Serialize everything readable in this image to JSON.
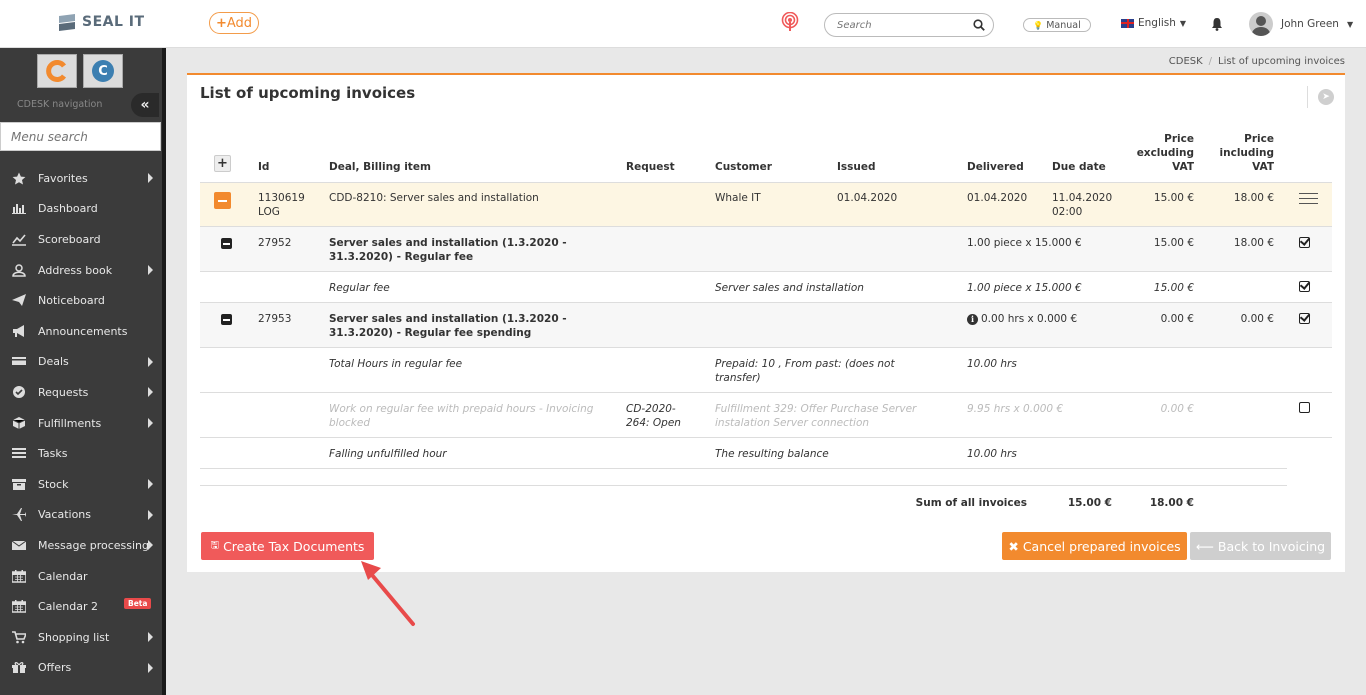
{
  "header": {
    "brand": "SEAL IT",
    "add_label": "Add",
    "search_placeholder": "Search",
    "manual_label": "Manual",
    "language": "English",
    "user_name": "John Green"
  },
  "sidebar": {
    "caption": "CDESK navigation",
    "app_icons": [
      "C",
      "C"
    ],
    "menu_search_placeholder": "Menu search",
    "items": [
      {
        "label": "Favorites",
        "icon": "star-icon",
        "submenu": true
      },
      {
        "label": "Dashboard",
        "icon": "bar-chart-icon",
        "submenu": false
      },
      {
        "label": "Scoreboard",
        "icon": "line-chart-icon",
        "submenu": false
      },
      {
        "label": "Address book",
        "icon": "user-icon",
        "submenu": true
      },
      {
        "label": "Noticeboard",
        "icon": "paper-plane-icon",
        "submenu": false
      },
      {
        "label": "Announcements",
        "icon": "bullhorn-icon",
        "submenu": false
      },
      {
        "label": "Deals",
        "icon": "money-icon",
        "submenu": true
      },
      {
        "label": "Requests",
        "icon": "check-circle-icon",
        "submenu": true
      },
      {
        "label": "Fulfillments",
        "icon": "cube-icon",
        "submenu": true
      },
      {
        "label": "Tasks",
        "icon": "tasks-icon",
        "submenu": false
      },
      {
        "label": "Stock",
        "icon": "archive-icon",
        "submenu": true
      },
      {
        "label": "Vacations",
        "icon": "plane-icon",
        "submenu": true
      },
      {
        "label": "Message processing",
        "icon": "envelope-icon",
        "submenu": true
      },
      {
        "label": "Calendar",
        "icon": "calendar-icon",
        "submenu": false
      },
      {
        "label": "Calendar 2",
        "icon": "calendar-icon",
        "submenu": false,
        "badge": "Beta"
      },
      {
        "label": "Shopping list",
        "icon": "cart-icon",
        "submenu": true
      },
      {
        "label": "Offers",
        "icon": "gift-icon",
        "submenu": true
      }
    ]
  },
  "breadcrumb": [
    "CDESK",
    "List of upcoming invoices"
  ],
  "page_title": "List of upcoming invoices",
  "table": {
    "headers": {
      "id": "Id",
      "deal": "Deal, Billing item",
      "request": "Request",
      "customer": "Customer",
      "issued": "Issued",
      "delivered": "Delivered",
      "due": "Due date",
      "price_ex_l1": "Price",
      "price_ex_l2": "excluding",
      "price_ex_l3": "VAT",
      "price_in_l1": "Price",
      "price_in_l2": "including",
      "price_in_l3": "VAT"
    },
    "invoice": {
      "id_l1": "1130619",
      "id_l2": "LOG",
      "deal": "CDD-8210: Server sales and installation",
      "customer": "Whale IT",
      "issued": "01.04.2020",
      "delivered": "01.04.2020",
      "due_l1": "11.04.2020",
      "due_l2": "02:00",
      "price_ex": "15.00 €",
      "price_in": "18.00 €"
    },
    "item1": {
      "id": "27952",
      "deal_l1": "Server sales and installation (1.3.2020 -",
      "deal_l2": "31.3.2020) - Regular fee",
      "qty": "1.00 piece x 15.000 €",
      "price_ex": "15.00 €",
      "price_in": "18.00 €"
    },
    "sub1": {
      "deal": "Regular fee",
      "customer": "Server sales and installation",
      "qty": "1.00 piece x 15.000 €",
      "price_ex": "15.00 €"
    },
    "item2": {
      "id": "27953",
      "deal_l1": "Server sales and installation (1.3.2020 -",
      "deal_l2": "31.3.2020) - Regular fee spending",
      "qty": "0.00 hrs x 0.000 €",
      "price_ex": "0.00 €",
      "price_in": "0.00 €"
    },
    "sub2": {
      "deal": "Total Hours in regular fee",
      "customer_l1": "Prepaid: 10 , From past: (does not",
      "customer_l2": "transfer)",
      "qty": "10.00 hrs"
    },
    "sub3": {
      "deal_l1": "Work on regular fee with prepaid hours - Invoicing",
      "deal_l2": "blocked",
      "request_l1": "CD-2020-",
      "request_l2": "264: Open",
      "customer_l1": "Fulfillment 329: Offer Purchase Server",
      "customer_l2": "instalation Server connection",
      "qty": "9.95 hrs x 0.000 €",
      "price_ex": "0.00 €"
    },
    "sub4": {
      "deal": "Falling unfulfilled hour",
      "customer": "The resulting balance",
      "qty": "10.00 hrs"
    },
    "sum": {
      "label": "Sum of all invoices",
      "price_ex": "15.00 €",
      "price_in": "18.00 €"
    }
  },
  "buttons": {
    "create": "Create Tax Documents",
    "cancel": "Cancel prepared invoices",
    "back": "Back to Invoicing"
  },
  "colors": {
    "accent": "#f28a2e",
    "danger": "#f05a5a",
    "sidebar": "#3b3b3b",
    "highlight_row": "#fdf6e3"
  }
}
